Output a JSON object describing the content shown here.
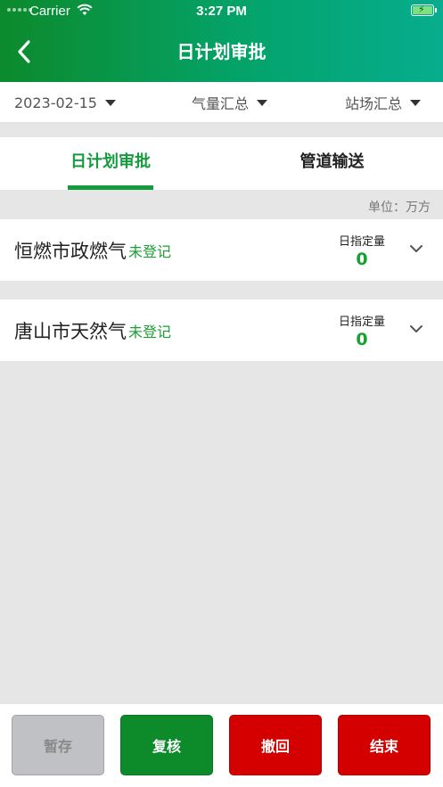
{
  "status_bar": {
    "carrier": "Carrier",
    "time": "3:27 PM"
  },
  "header": {
    "title": "日计划审批"
  },
  "filters": {
    "date": "2023-02-15",
    "gas_summary": "气量汇总",
    "station_summary": "站场汇总"
  },
  "tabs": [
    {
      "label": "日计划审批",
      "active": true
    },
    {
      "label": "管道输送",
      "active": false
    }
  ],
  "unit_label": "单位：万方",
  "companies": [
    {
      "name": "恒燃市政燃气",
      "status": "未登记",
      "quantity_label": "日指定量",
      "quantity": "0"
    },
    {
      "name": "唐山市天然气",
      "status": "未登记",
      "quantity_label": "日指定量",
      "quantity": "0"
    }
  ],
  "actions": {
    "save": "暂存",
    "review": "复核",
    "withdraw": "撤回",
    "finish": "结束"
  },
  "colors": {
    "accent_green": "#159b3d",
    "danger_red": "#d40000",
    "disabled_gray": "#bfc1c5"
  }
}
